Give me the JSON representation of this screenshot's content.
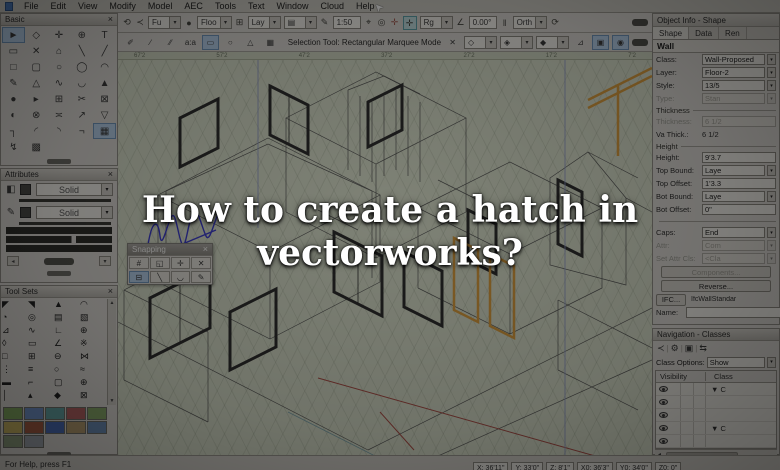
{
  "overlay": {
    "title_line1": "How to create a hatch in",
    "title_line2": "vectorworks?"
  },
  "menubar": {
    "menus": [
      {
        "g": "File",
        "n": "menu-file"
      },
      {
        "g": "Edit",
        "n": "menu-edit"
      },
      {
        "g": "View",
        "n": "menu-view"
      },
      {
        "g": "Modify",
        "n": "menu-modify"
      },
      {
        "g": "Model",
        "n": "menu-model"
      },
      {
        "g": "AEC",
        "n": "menu-aec"
      },
      {
        "g": "Tools",
        "n": "menu-tools"
      },
      {
        "g": "Text",
        "n": "menu-text"
      },
      {
        "g": "Window",
        "n": "menu-window"
      },
      {
        "g": "Cloud",
        "n": "menu-cloud"
      },
      {
        "g": "Help",
        "n": "menu-help"
      }
    ]
  },
  "icons": {
    "undo": "⟲",
    "share": "≺",
    "lock": "●",
    "layers": "⊞",
    "saveview": "▤",
    "pen": "✎",
    "zoomline": "⌖",
    "zoomobj": "◎",
    "move": "✛",
    "snapind": "✛",
    "angle": "∠",
    "flag": "‖",
    "refresh": "⟳",
    "m1": "✐",
    "m2": "∕",
    "m3": "∕∕",
    "m4": "a:a",
    "m5": "▭",
    "m6": "○",
    "m7": "△",
    "m8": "▦",
    "r1": "✕",
    "r2": "◇",
    "r3": "◈",
    "r4": "◆",
    "r5": "⊿",
    "r6": "▣",
    "r7": "◉",
    "caret": "▾",
    "navshare": "≺",
    "navopt": "⚙",
    "navimg": "▣",
    "navsync": "⇆",
    "attrfill": "◧",
    "attrpen": "✎",
    "harrow": "◂",
    "close": "×",
    "cursor": "➤"
  },
  "viewbar": {
    "saved_views": "Fu",
    "layer": "Floo",
    "class_dd": "Lay",
    "scale": "1:50",
    "render_mode": "Rg",
    "angle": "0.00°",
    "projection": "Orth"
  },
  "toolbar": {
    "mode_hint": "Selection Tool: Rectangular Marquee Mode"
  },
  "ruler": {
    "labels": [
      "67'2",
      "57'2",
      "47'2",
      "37'2",
      "27'2",
      "17'2",
      "7'2"
    ]
  },
  "palettes": {
    "basic": {
      "title": "Basic",
      "tools": [
        {
          "g": "►",
          "n": "selection-tool",
          "sel": true
        },
        "◇",
        "✛",
        "⊕",
        "T",
        "▭",
        "✕",
        "⌂",
        "╲",
        "╱",
        "□",
        "▢",
        "○",
        "◯",
        "◠",
        "✎",
        "△",
        "∿",
        "◡",
        "▲",
        "●",
        "▸",
        "⊞",
        "✂",
        "⊠",
        "◐",
        "⊗",
        "≍",
        "↗",
        "▽",
        "┐",
        "◜",
        "◝",
        "¬",
        {
          "g": "▦",
          "n": "image-tool",
          "sel": true
        },
        "↯",
        "▩"
      ]
    },
    "attributes": {
      "title": "Attributes",
      "fill_style": "Solid",
      "pen_style": "Solid"
    },
    "tool_sets": {
      "title": "Tool Sets",
      "tools": [
        "◤",
        "◥",
        "▲",
        "◠",
        "◔",
        "◎",
        "▤",
        "▧",
        "⊿",
        "∿",
        "∟",
        "⊕",
        "◊",
        "▭",
        "∠",
        "※",
        "□",
        "⊞",
        "⊖",
        "⋈",
        "⋮",
        "≡",
        "○",
        "≈",
        "▬",
        "⌐",
        "▢",
        "⊕",
        "│",
        "▴",
        "◆",
        "⊠"
      ],
      "sets": [
        {
          "c": "#7fa45e",
          "n": "toolset-tile"
        },
        {
          "c": "#6f8fc4",
          "n": "toolset-tile"
        },
        {
          "c": "#62a0a0",
          "n": "toolset-tile"
        },
        {
          "c": "#b06060",
          "n": "toolset-tile"
        },
        {
          "c": "#86a668",
          "n": "toolset-tile"
        },
        {
          "c": "#c4b060",
          "n": "toolset-tile"
        },
        {
          "c": "#a05a42",
          "n": "toolset-tile"
        },
        {
          "c": "#4a6ab2",
          "n": "toolset-tile"
        },
        {
          "c": "#b29a6e",
          "n": "toolset-tile"
        },
        {
          "c": "#6a8ab2",
          "n": "toolset-tile"
        },
        {
          "c": "#8a9a7a",
          "n": "toolset-tile"
        },
        {
          "c": "#9aa0a8",
          "n": "toolset-tile"
        }
      ]
    },
    "snapping": {
      "title": "Snapping",
      "row1": [
        "#",
        "◱",
        "✛",
        "✕"
      ],
      "row2": [
        {
          "g": "⊟",
          "sel": true
        },
        "╲",
        "◡",
        "✎"
      ]
    }
  },
  "object_info": {
    "title": "Object Info - Shape",
    "tabs": [
      "Shape",
      "Data",
      "Ren"
    ],
    "object_type": "Wall",
    "sections": {
      "thickness": "Thickness",
      "height": "Height"
    },
    "fields": [
      {
        "label": "Class:",
        "value": "Wall-Proposed"
      },
      {
        "label": "Layer:",
        "value": "Floor-2"
      },
      {
        "label": "Style:",
        "value": "13/5"
      },
      {
        "label": "Type:",
        "value": "Stan"
      },
      {
        "label": "Thickness:",
        "value": "6 1/2"
      },
      {
        "label": "Va Thick.:",
        "value": "6 1/2"
      },
      {
        "label": "Height:",
        "value": "9'3.7"
      },
      {
        "label": "Top Bound:",
        "value": "Laye"
      },
      {
        "label": "Top Offset:",
        "value": "1'3.3"
      },
      {
        "label": "Bot Bound:",
        "value": "Laye"
      },
      {
        "label": "Bot Offset:",
        "value": "0\""
      },
      {
        "label": "Caps:",
        "value": "End"
      },
      {
        "label": "Attr:",
        "value": "Com"
      },
      {
        "label": "Set Attr Cls:",
        "value": "<Cla"
      }
    ],
    "buttons": {
      "components": "Components...",
      "reverse": "Reverse...",
      "ifc": "IFC...",
      "ifc_value": "IfcWallStandar"
    },
    "name_label": "Name:",
    "name_value": ""
  },
  "navigation": {
    "title": "Navigation - Classes",
    "class_options_label": "Class Options:",
    "class_options_value": "Show",
    "columns": [
      "Visibility",
      "Class"
    ],
    "rows": [
      {
        "label": "▼ C"
      },
      {
        "label": ""
      },
      {
        "label": ""
      },
      {
        "label": "▼ C"
      },
      {
        "label": ""
      }
    ]
  },
  "status_bar": {
    "help_text": "For Help, press F1",
    "coords": [
      "X: 36'11\"",
      "Y: 33'0\"",
      "Z: 8'1\"",
      "X0: 36'3\"",
      "Y0: 34'0\"",
      "Z0: 0\""
    ]
  },
  "colors": {
    "canvas": "#d3d9c5",
    "selection_highlight": "#b2cbe4",
    "frame_orange": "#d59a3e",
    "axis_red": "#a84c44",
    "axis_blue": "#8a94c2",
    "scribble_blue": "#3c3cc8"
  }
}
